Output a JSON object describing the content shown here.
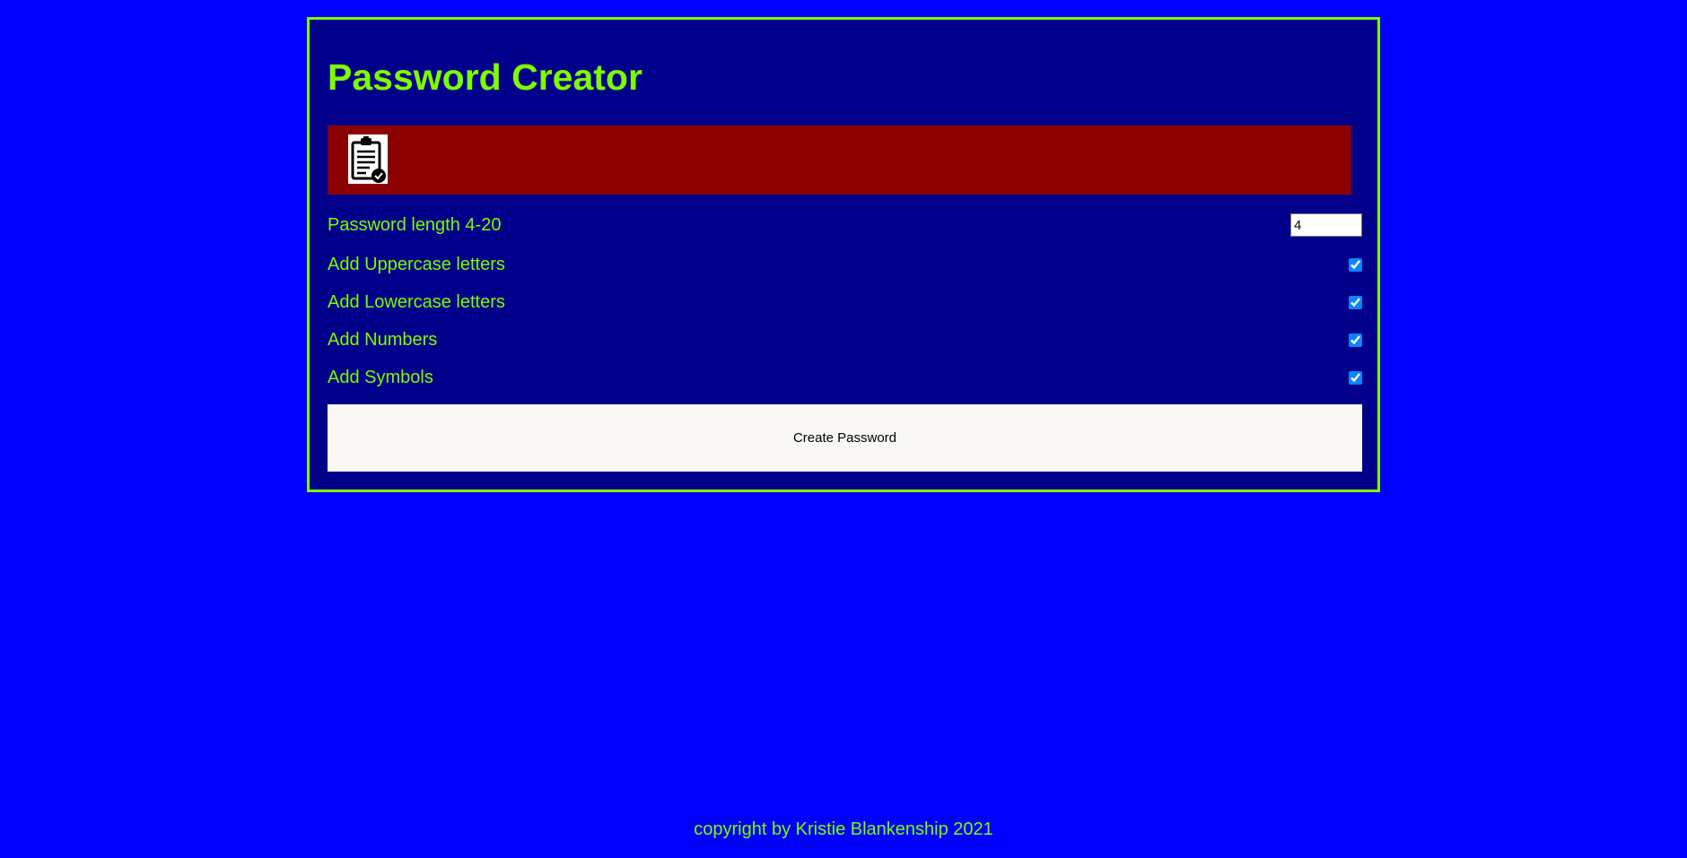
{
  "app": {
    "title": "Password Creator"
  },
  "result": {
    "copy_icon": "clipboard-check-icon",
    "background": "#8b0000"
  },
  "options": {
    "length_label": "Password length 4-20",
    "length_value": "4",
    "uppercase_label": "Add Uppercase letters",
    "uppercase_checked": true,
    "lowercase_label": "Add Lowercase letters",
    "lowercase_checked": true,
    "numbers_label": "Add Numbers",
    "numbers_checked": true,
    "symbols_label": "Add Symbols",
    "symbols_checked": true
  },
  "actions": {
    "create_label": "Create Password"
  },
  "footer": {
    "text": "copyright by Kristie Blankenship 2021"
  },
  "colors": {
    "page_background": "#0000ff",
    "panel_background": "#00008b",
    "accent": "#7cfc00",
    "button_background": "#faf8f5"
  }
}
